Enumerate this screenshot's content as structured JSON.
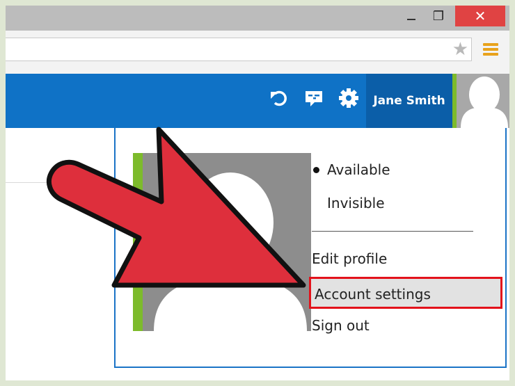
{
  "window": {
    "close_glyph": "✕",
    "maximize_glyph": "❐"
  },
  "browser": {
    "star_glyph": "★"
  },
  "header": {
    "user_name": "Jane Smith"
  },
  "account_menu": {
    "items": [
      {
        "label": "Available",
        "status_dot": true
      },
      {
        "label": "Invisible"
      },
      {
        "label": "Edit profile"
      },
      {
        "label": "Account settings",
        "highlighted": true
      },
      {
        "label": "Sign out"
      }
    ]
  },
  "colors": {
    "app_header": "#0f72c6",
    "user_name_bg": "#0b5ea8",
    "presence_green": "#7dbb2b",
    "highlight_border": "#e3121b",
    "pointer_arrow": "#de2f3c"
  },
  "icons": [
    "undo-icon",
    "feedback-chat-icon",
    "gear-icon",
    "star-icon",
    "hamburger-menu-icon",
    "avatar-icon",
    "pointer-arrow-icon"
  ]
}
